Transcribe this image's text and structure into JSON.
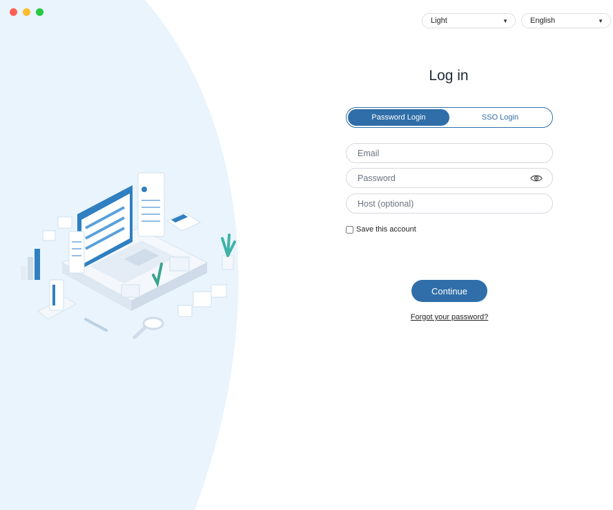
{
  "theme_select": {
    "value": "Light"
  },
  "language_select": {
    "value": "English"
  },
  "login": {
    "title": "Log in",
    "tabs": [
      {
        "label": "Password Login",
        "active": true
      },
      {
        "label": "SSO Login",
        "active": false
      }
    ],
    "email_placeholder": "Email",
    "password_placeholder": "Password",
    "host_placeholder": "Host (optional)",
    "save_account_label": "Save this account",
    "save_account_checked": false,
    "continue_label": "Continue",
    "forgot_label": "Forgot your password?"
  },
  "colors": {
    "accent": "#2f6ea8",
    "panel_bg": "#e9f4fd"
  }
}
